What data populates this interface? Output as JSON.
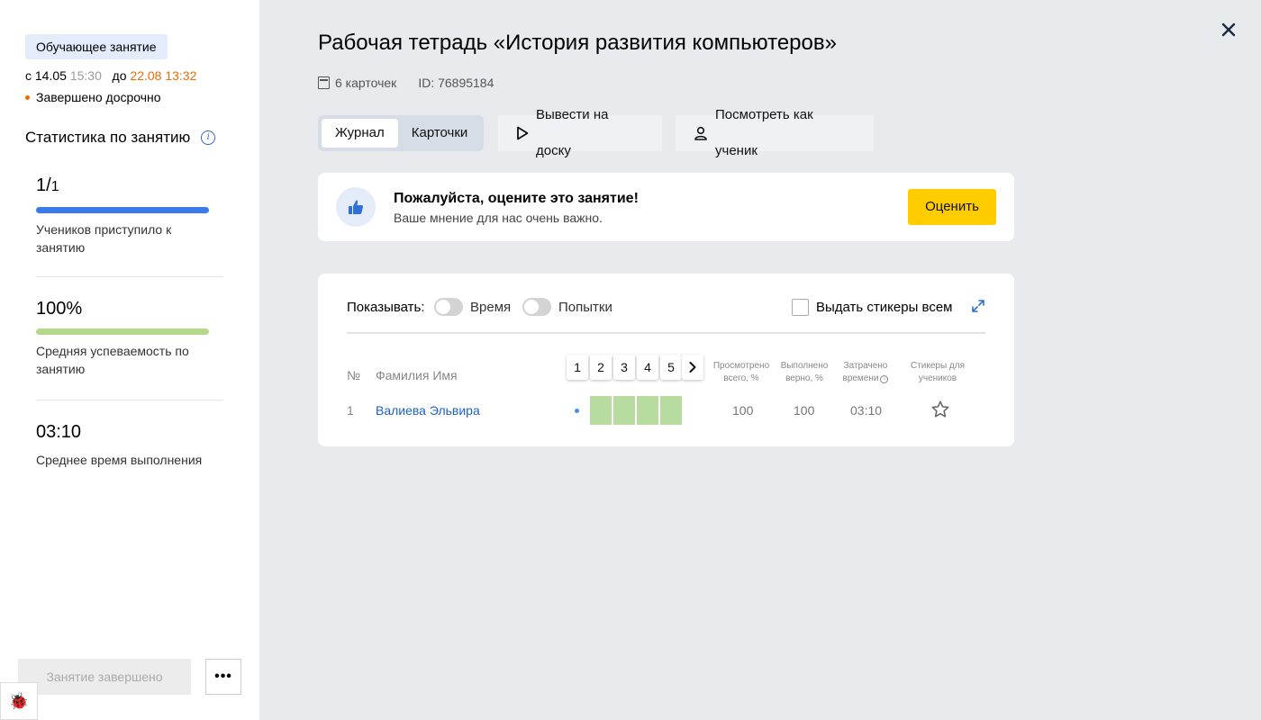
{
  "sidebar": {
    "badge": "Обучающее занятие",
    "date_from_prefix": "с",
    "date_from": "14.05",
    "time_from": "15:30",
    "date_to_prefix": "до",
    "date_to": "22.08",
    "time_to": "13:32",
    "status": "Завершено досрочно",
    "stats_title": "Статистика по занятию",
    "stats": [
      {
        "value_main": "1/",
        "value_small": "1",
        "progress": 1.0,
        "color": "#3b7ae8",
        "label": "Учеников приступило к занятию"
      },
      {
        "value_main": "100%",
        "value_small": "",
        "progress": 1.0,
        "color": "#b5d98a",
        "label": "Средняя успеваемость по занятию"
      },
      {
        "value_main": "03:10",
        "value_small": "",
        "label": "Среднее время выполнения"
      }
    ],
    "done_button": "Занятие завершено",
    "more_button": "•••"
  },
  "header": {
    "title": "Рабочая тетрадь «История развития компьютеров»",
    "cards_count": "6 карточек",
    "id": "ID: 76895184"
  },
  "toolbar": {
    "tab_journal": "Журнал",
    "tab_cards": "Карточки",
    "board_button": "Вывести на доску",
    "student_view_button": "Посмотреть как ученик"
  },
  "rating": {
    "title": "Пожалуйста, оцените это занятие!",
    "subtitle": "Ваше мнение для нас очень важно.",
    "button": "Оценить"
  },
  "journal": {
    "show_label": "Показывать:",
    "toggle_time": "Время",
    "toggle_attempts": "Попытки",
    "stickers_all": "Выдать стикеры всем",
    "col_num": "№",
    "col_name": "Фамилия Имя",
    "card_numbers": [
      "1",
      "2",
      "3",
      "4",
      "5"
    ],
    "col_viewed": "Просмотрено всего, %",
    "col_correct": "Выполнено верно, %",
    "col_time": "Затрачено времени",
    "col_stickers": "Стикеры для учеников",
    "rows": [
      {
        "num": "1",
        "name": "Валиева Эльвира",
        "viewed": "100",
        "correct": "100",
        "time": "03:10"
      }
    ]
  }
}
